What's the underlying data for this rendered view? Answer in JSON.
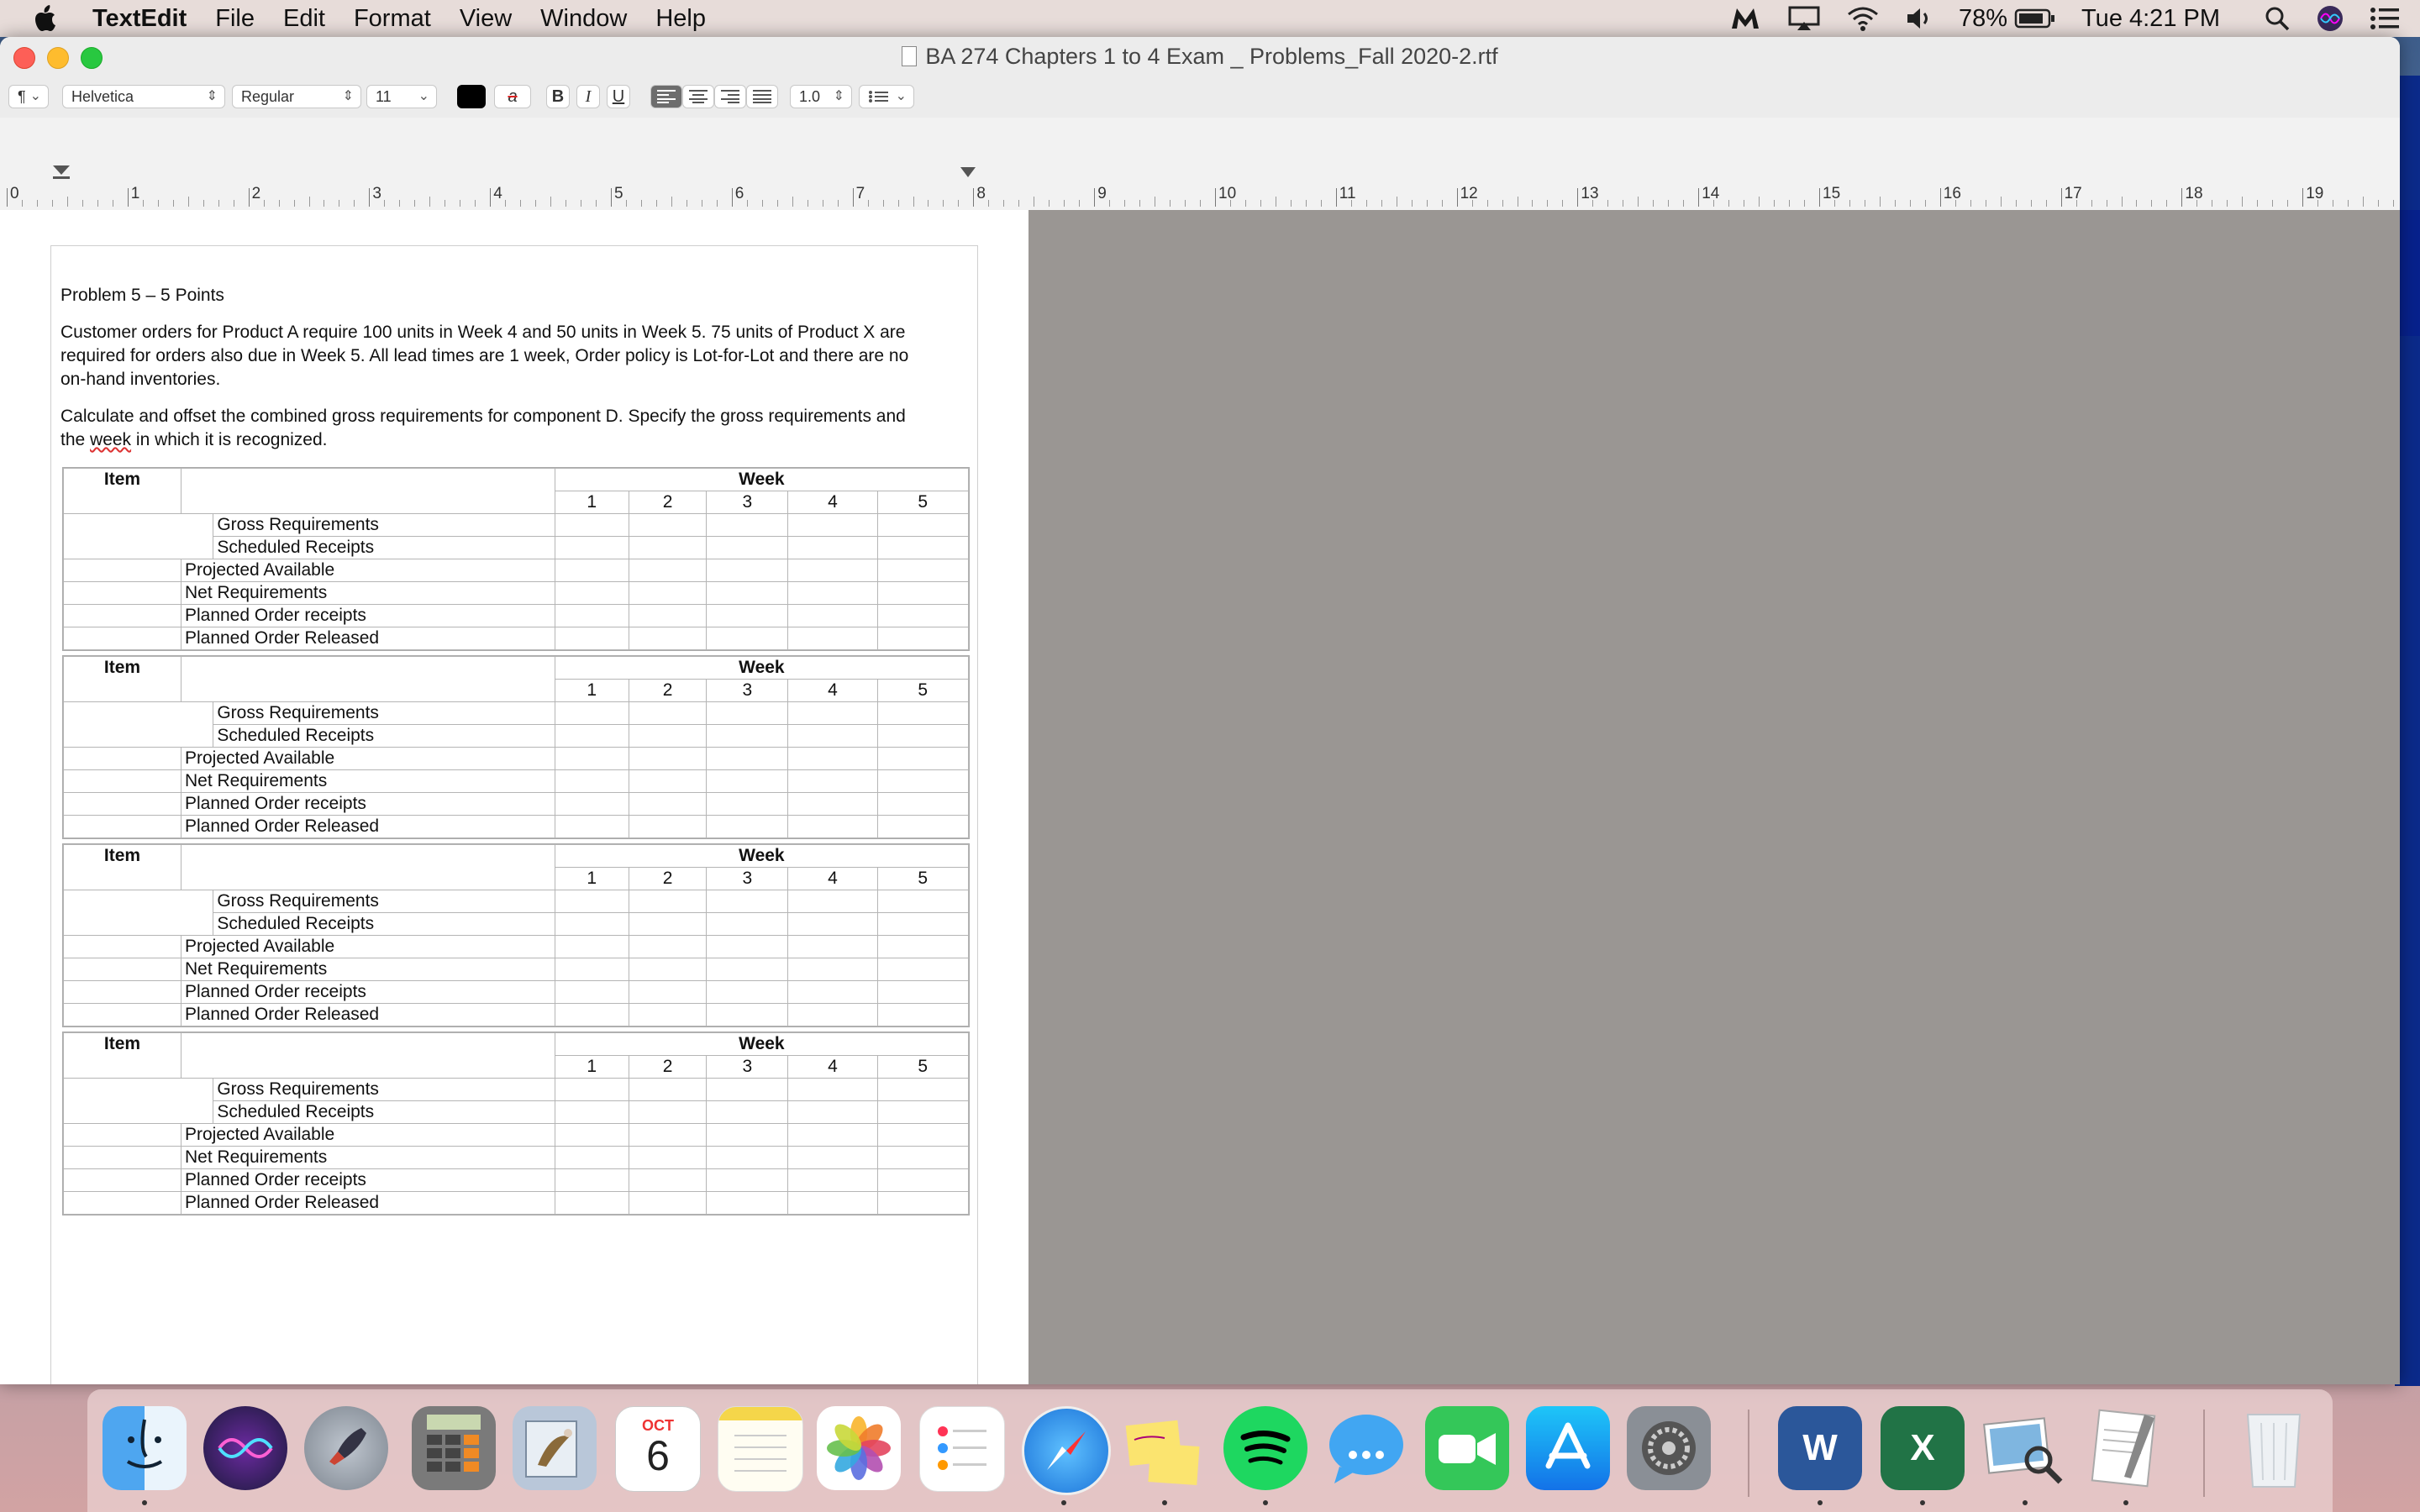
{
  "menubar": {
    "app_name": "TextEdit",
    "items": [
      "File",
      "Edit",
      "Format",
      "View",
      "Window",
      "Help"
    ],
    "battery": "78%",
    "clock": "Tue 4:21 PM"
  },
  "window": {
    "title": "BA 274 Chapters 1 to 4 Exam _ Problems_Fall 2020-2.rtf"
  },
  "toolbar": {
    "paragraph_style": "¶",
    "font_family": "Helvetica",
    "font_style": "Regular",
    "font_size": "11",
    "bold": "B",
    "italic": "I",
    "underline": "U",
    "line_spacing": "1.0",
    "highlight_glyph": "a"
  },
  "ruler": {
    "numbers": [
      "0",
      "1",
      "2",
      "3",
      "4",
      "5",
      "6",
      "7",
      "8",
      "9",
      "10",
      "11",
      "12",
      "13",
      "14",
      "15",
      "16",
      "17",
      "18",
      "19"
    ]
  },
  "document": {
    "heading": "Problem 5 – 5 Points",
    "para1_line1": "Customer orders for Product A require 100 units in Week 4 and 50 units in Week 5.  75 units of Product X are",
    "para1_line2": "required for orders also due in Week 5.  All lead times are 1 week, Order policy is Lot-for-Lot and there are no",
    "para1_line3": "on-hand inventories.",
    "para2_line1": "Calculate and offset the combined gross requirements for component D.  Specify the gross requirements and",
    "para2_line2_a": "the ",
    "para2_line2_week": "week",
    "para2_line2_b": " in which it is recognized."
  },
  "mrp_table": {
    "item_label": "Item",
    "week_label": "Week",
    "weeks": [
      "1",
      "2",
      "3",
      "4",
      "5"
    ],
    "rows": [
      "Gross Requirements",
      "Scheduled Receipts",
      "Projected Available",
      "Net Requirements",
      "Planned Order receipts",
      "Planned Order Released"
    ]
  },
  "dock": {
    "items": [
      "Finder",
      "Siri",
      "Launchpad",
      "Calculator",
      "Mail",
      "Calendar",
      "Notes",
      "Photos",
      "Reminders",
      "Safari",
      "Stickies",
      "Spotify",
      "Messages",
      "FaceTime",
      "App Store",
      "System Preferences",
      "Microsoft Word",
      "Microsoft Excel",
      "Preview",
      "TextEdit",
      "Trash"
    ],
    "calendar_month": "OCT",
    "calendar_day": "6",
    "word_letter": "W",
    "excel_letter": "X"
  },
  "colors": {
    "close": "#fd5f57",
    "minimize": "#febc2e",
    "maximize": "#28c840",
    "canvas_gray": "#9a9693"
  }
}
